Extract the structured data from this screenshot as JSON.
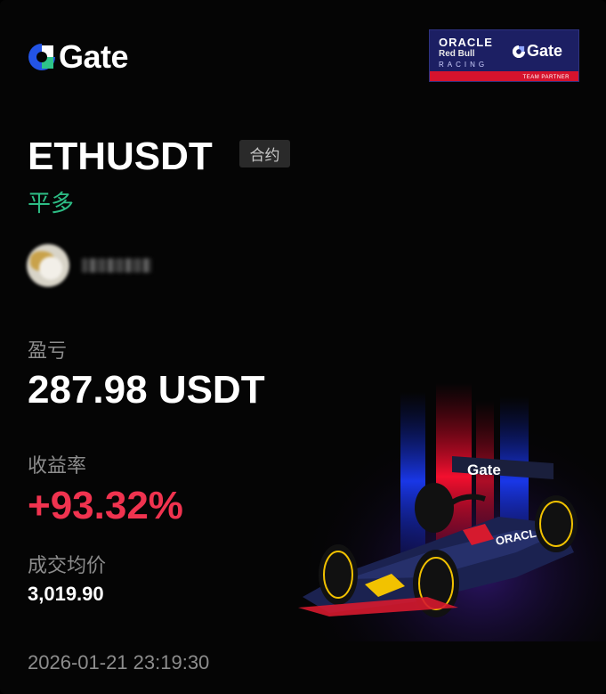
{
  "brand": {
    "name": "Gate",
    "icon": "gate-logo-icon"
  },
  "partner": {
    "oracle": "ORACLE",
    "redbull": "Red Bull",
    "racing": "RACING",
    "gate": "Gate",
    "subtitle": "TEAM PARTNER",
    "colors": {
      "bg": "#1c1f63",
      "strip": "#d6132d"
    }
  },
  "position": {
    "symbol": "ETHUSDT",
    "tag": "合约",
    "side": "平多",
    "side_color": "#2dbd85"
  },
  "user": {
    "avatar": "avatar",
    "nickname": ""
  },
  "stats": {
    "pnl_label": "盈亏",
    "pnl_value": "287.98 USDT",
    "roi_label": "收益率",
    "roi_value": "+93.32%",
    "roi_color": "#f0334f",
    "avg_label": "成交均价",
    "avg_value": "3,019.90"
  },
  "timestamp": "2026-01-21 23:19:30",
  "art": {
    "car_text": "Gate",
    "sponsor_text": "ORACLE"
  }
}
